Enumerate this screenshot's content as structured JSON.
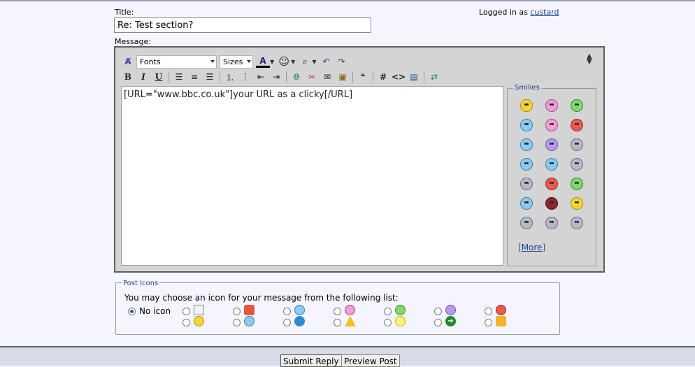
{
  "form": {
    "title_label": "Title:",
    "title_value": "Re: Test section?",
    "logged_in_prefix": "Logged in as",
    "username": "custard",
    "message_label": "Message:"
  },
  "toolbar": {
    "font_select": "Fonts",
    "size_select": "Sizes",
    "bold": "B",
    "italic": "I",
    "underline": "U",
    "code_hash": "#",
    "html_tag": "<>",
    "toggle": "↕"
  },
  "editor": {
    "content": "[URL=\"www.bbc.co.uk\"]your URL as a clicky[/URL]"
  },
  "smilies": {
    "legend": "Smilies",
    "more_open": "[",
    "more_label": "More",
    "more_close": "]",
    "icons": [
      "smile-icon",
      "tongue-icon",
      "grin-icon",
      "wink-icon",
      "laugh-icon",
      "angry-icon",
      "confused-icon",
      "mad-icon",
      "eek-icon",
      "cool-icon",
      "frown-icon",
      "thumbsup-icon",
      "thinking-icon",
      "banging-icon",
      "sick-icon",
      "cry-icon",
      "devil-icon",
      "idea-icon",
      "argue-icon",
      "lightbulb-icon",
      "rolleyes-icon"
    ]
  },
  "post_icons": {
    "legend": "Post Icons",
    "prompt": "You may choose an icon for your message from the following list:",
    "no_icon_label": "No icon",
    "icons": [
      "document-icon",
      "smile-icon",
      "thumbsdown-icon",
      "cool-icon",
      "wink-icon",
      "question-icon",
      "tongue-icon",
      "warning-icon",
      "grin-icon",
      "lightbulb-icon",
      "frown-icon",
      "arrow-icon",
      "angry-icon",
      "thumbsup-icon"
    ]
  },
  "buttons": {
    "submit": "Submit Reply",
    "preview": "Preview Post"
  }
}
